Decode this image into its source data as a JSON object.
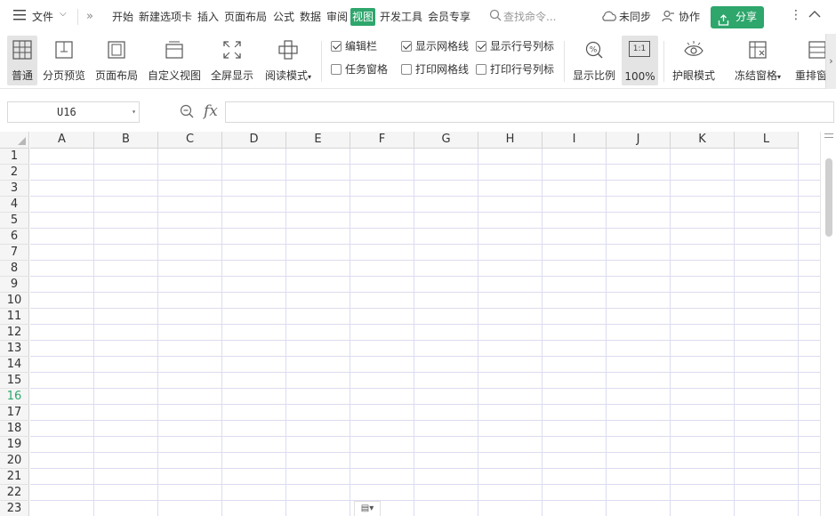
{
  "menubar": {
    "file_label": "文件",
    "more_label": "»",
    "tabs": [
      "开始",
      "新建选项卡",
      "插入",
      "页面布局",
      "公式",
      "数据",
      "审阅",
      "视图",
      "开发工具",
      "会员专享"
    ],
    "active_tab": "视图",
    "search_placeholder": "查找命令...",
    "sync_label": "未同步",
    "collab_label": "协作",
    "share_label": "分享",
    "accent_color": "#2ea66c"
  },
  "ribbon": {
    "normal": "普通",
    "page_break_preview": "分页预览",
    "page_layout": "页面布局",
    "custom_view": "自定义视图",
    "fullscreen": "全屏显示",
    "reading_mode": "阅读模式",
    "checks": {
      "formula_bar": {
        "label": "编辑栏",
        "checked": true
      },
      "task_pane": {
        "label": "任务窗格",
        "checked": false
      },
      "show_gridlines": {
        "label": "显示网格线",
        "checked": true
      },
      "print_gridlines": {
        "label": "打印网格线",
        "checked": false
      },
      "show_headings": {
        "label": "显示行号列标",
        "checked": true
      },
      "print_headings": {
        "label": "打印行号列标",
        "checked": false
      }
    },
    "zoom_ratio": "显示比例",
    "zoom_100": "100%",
    "zoom_icon_text": "1:1",
    "eye_protection": "护眼模式",
    "freeze_panes": "冻结窗格",
    "rearrange": "重排窗口"
  },
  "formula_bar": {
    "name_box": "U16",
    "fx_label": "fx",
    "formula_value": ""
  },
  "grid": {
    "columns": [
      "A",
      "B",
      "C",
      "D",
      "E",
      "F",
      "G",
      "H",
      "I",
      "J",
      "K",
      "L"
    ],
    "rows": [
      "1",
      "2",
      "3",
      "4",
      "5",
      "6",
      "7",
      "8",
      "9",
      "10",
      "11",
      "12",
      "13",
      "14",
      "15",
      "16",
      "17",
      "18",
      "19",
      "20",
      "21",
      "22",
      "23"
    ],
    "current_row": "16"
  }
}
